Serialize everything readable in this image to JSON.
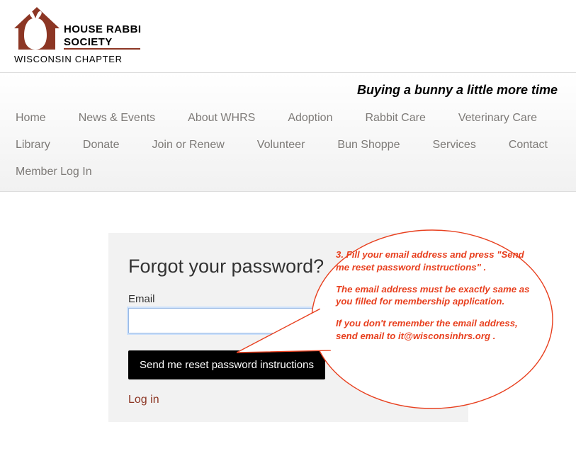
{
  "logo": {
    "name_line1": "HOUSE RABBIT",
    "name_line2": "SOCIETY",
    "chapter": "WISCONSIN CHAPTER"
  },
  "tagline": "Buying a bunny a little more time",
  "nav": [
    "Home",
    "News & Events",
    "About WHRS",
    "Adoption",
    "Rabbit Care",
    "Veterinary Care",
    "Library",
    "Donate",
    "Join or Renew",
    "Volunteer",
    "Bun Shoppe",
    "Services",
    "Contact",
    "Member Log In"
  ],
  "form": {
    "title": "Forgot your password?",
    "email_label": "Email",
    "email_value": "",
    "submit_label": "Send me reset password instructions",
    "login_link": "Log in"
  },
  "callout": {
    "p1": "3. Fill your email address and press \"Send me reset password instructions\" .",
    "p2": "The email address must be exactly same as you filled for membership application.",
    "p3": "If you don't remember the email address, send email to it@wisconsinhrs.org ."
  },
  "colors": {
    "accent": "#8c3624",
    "callout": "#e8401f"
  }
}
